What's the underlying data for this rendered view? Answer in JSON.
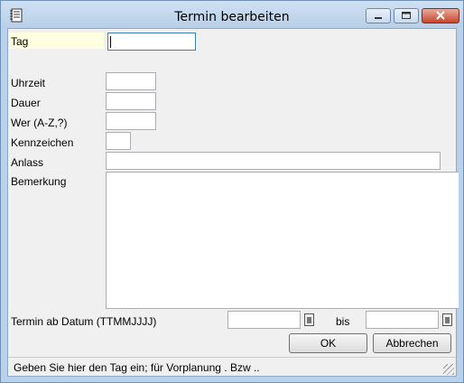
{
  "window": {
    "title": "Termin bearbeiten"
  },
  "fields": {
    "tag": {
      "label": "Tag",
      "value": ""
    },
    "uhrzeit": {
      "label": "Uhrzeit",
      "value": ""
    },
    "dauer": {
      "label": "Dauer",
      "value": ""
    },
    "wer": {
      "label": "Wer (A-Z,?)",
      "value": ""
    },
    "kennzeichen": {
      "label": "Kennzeichen",
      "value": ""
    },
    "anlass": {
      "label": "Anlass",
      "value": ""
    },
    "bemerkung": {
      "label": "Bemerkung",
      "value": ""
    }
  },
  "date_range": {
    "label": "Termin ab Datum (TTMMJJJJ)",
    "bis_label": "bis",
    "from": "",
    "to": ""
  },
  "buttons": {
    "ok": "OK",
    "cancel": "Abbrechen"
  },
  "status": {
    "text": "Geben Sie hier den Tag ein; für Vorplanung . Bzw .."
  },
  "icons": {
    "app": "notebook-icon",
    "minimize": "minimize-icon",
    "maximize": "maximize-icon",
    "close": "close-icon",
    "calendar": "calendar-icon"
  }
}
